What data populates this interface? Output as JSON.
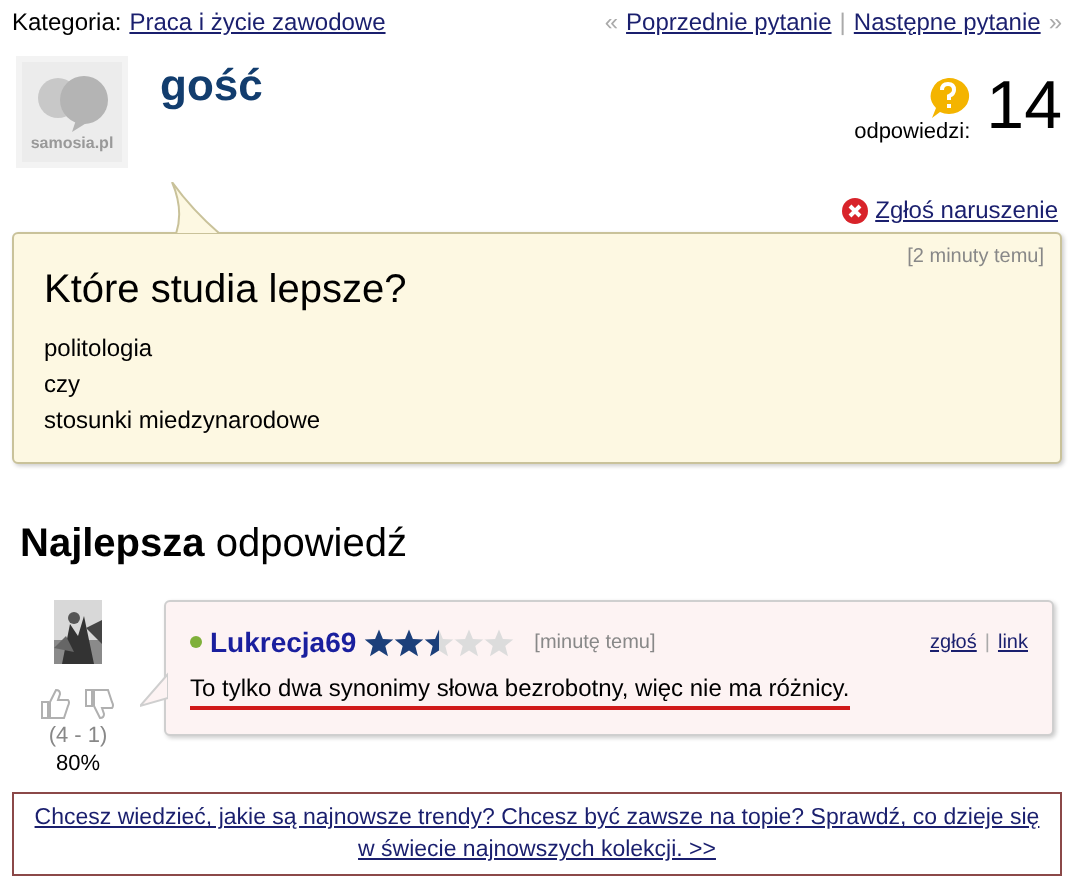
{
  "category": {
    "label": "Kategoria:",
    "link": "Praca i życie zawodowe"
  },
  "nav": {
    "prev_mark": "«",
    "prev": "Poprzednie pytanie",
    "separator": "|",
    "next": "Następne pytanie",
    "next_mark": "»"
  },
  "author": {
    "avatar_label": "samosia.pl",
    "name": "gość"
  },
  "answers": {
    "label": "odpowiedzi:",
    "count": "14"
  },
  "report": "Zgłoś naruszenie",
  "question": {
    "time": "[2 minuty temu]",
    "title": "Które studia lepsze?",
    "lines": [
      "politologia",
      "czy",
      "stosunki miedzynarodowe"
    ]
  },
  "best_heading": "**Najlepsza** odpowiedź",
  "best_answer": {
    "user": "Lukrecja69",
    "online": true,
    "stars": 2.5,
    "time": "[minutę temu]",
    "report": "zgłoś",
    "separator": "|",
    "link": "link",
    "text": "To tylko dwa synonimy słowa bezrobotny, więc nie ma różnicy.",
    "votes": "(4 - 1)",
    "percent": "80%"
  },
  "ad": "Chcesz wiedzieć, jakie są najnowsze trendy? Chcesz być zawsze na topie? Sprawdź, co dzieje się w świecie najnowszych kolekcji. >>"
}
